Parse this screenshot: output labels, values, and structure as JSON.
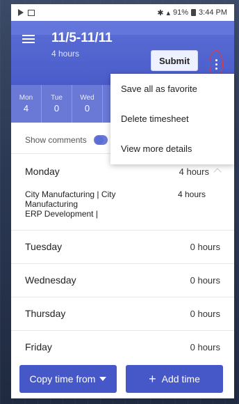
{
  "status_bar": {
    "battery": "91%",
    "time": "3:44 PM"
  },
  "header": {
    "title": "11/5-11/11",
    "subtitle": "4 hours",
    "submit_label": "Submit"
  },
  "week_days": [
    {
      "name": "Mon",
      "value": "4"
    },
    {
      "name": "Tue",
      "value": "0"
    },
    {
      "name": "Wed",
      "value": "0"
    }
  ],
  "comments": {
    "label": "Show comments"
  },
  "menu": {
    "items": [
      {
        "label": "Save all as favorite"
      },
      {
        "label": "Delete timesheet"
      },
      {
        "label": "View more details"
      }
    ]
  },
  "days": [
    {
      "name": "Monday",
      "hours": "4 hours"
    },
    {
      "name": "Tuesday",
      "hours": "0 hours"
    },
    {
      "name": "Wednesday",
      "hours": "0 hours"
    },
    {
      "name": "Thursday",
      "hours": "0 hours"
    },
    {
      "name": "Friday",
      "hours": "0 hours"
    }
  ],
  "entry": {
    "line1": "City Manufacturing | City",
    "line2": "Manufacturing",
    "line3": "ERP Development |",
    "hours": "4 hours"
  },
  "actions": {
    "copy_label": "Copy time from",
    "add_label": "Add time"
  },
  "colors": {
    "primary": "#4658c7",
    "header": "#5b6ed6",
    "highlight_ring": "#e53935"
  }
}
